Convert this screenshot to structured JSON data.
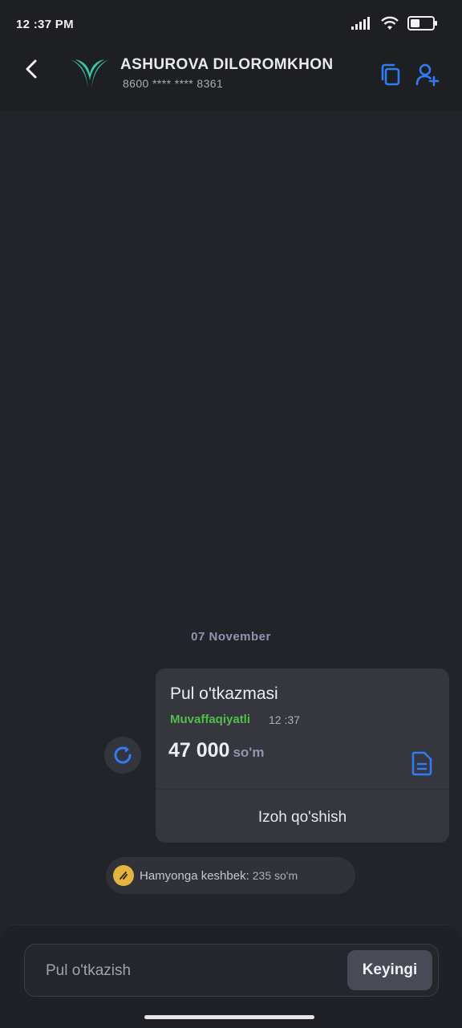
{
  "status_bar": {
    "time": "12 :37 PM",
    "battery_percent": 40
  },
  "header": {
    "name": "ASHUROVA DILOROMKHON",
    "card_number": "8600 **** **** 8361",
    "icons": {
      "back": "chevron-left-icon",
      "logo": "bank-logo",
      "copy": "copy-icon",
      "add_contact": "add-contact-icon"
    }
  },
  "chat": {
    "date_label": "07 November",
    "transfer": {
      "title": "Pul o'tkazmasi",
      "status": "Muvaffaqiyatli",
      "time": "12 :37",
      "amount": "47 000",
      "currency": "so'm",
      "add_comment_label": "Izoh qo'shish"
    },
    "cashback": {
      "label": "Hamyonga keshbek:",
      "amount": "235 so'm"
    }
  },
  "composer": {
    "placeholder": "Pul o'tkazish",
    "value": "",
    "next_label": "Keyingi"
  },
  "colors": {
    "accent": "#2f7cf6",
    "success": "#4fbf4a",
    "logo_green": "#2bb592",
    "coin": "#e3b53c"
  }
}
